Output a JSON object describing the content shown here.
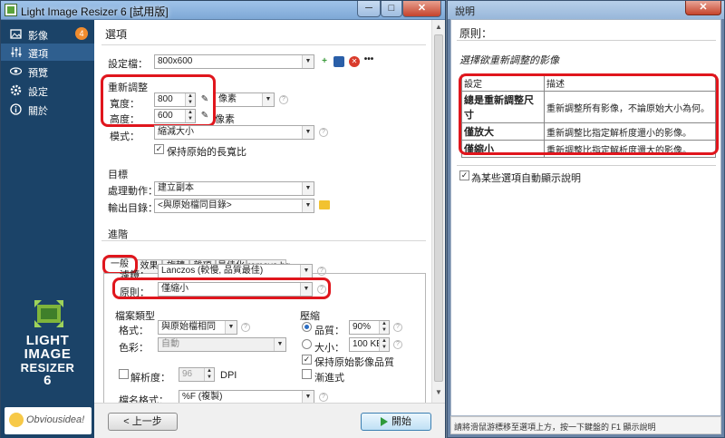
{
  "main_window": {
    "title": "Light Image Resizer 6 [試用版]",
    "controls": {
      "minimize": "─",
      "maximize": "□",
      "close": "✕"
    }
  },
  "sidebar": {
    "items": [
      {
        "icon": "images-icon",
        "label": "影像",
        "badge": "4"
      },
      {
        "icon": "options-icon",
        "label": "選項"
      },
      {
        "icon": "preview-icon",
        "label": "預覽"
      },
      {
        "icon": "settings-icon",
        "label": "設定"
      },
      {
        "icon": "about-icon",
        "label": "關於"
      }
    ],
    "brand_lines": [
      "LIGHT",
      "IMAGE",
      "RESIZER",
      "6"
    ],
    "publisher": "Obviousidea!"
  },
  "options": {
    "page_title": "選項",
    "profile_label": "設定檔：",
    "profile_value": "800x600",
    "resize_section": "重新調整",
    "width_label": "寬度：",
    "width_value": "800",
    "height_label": "高度：",
    "height_value": "600",
    "unit_value": "像素",
    "unit_static": "像素",
    "mode_label": "模式：",
    "mode_value": "縮減大小",
    "keep_ratio_label": "保持原始的長寬比",
    "target_section": "目標",
    "action_label": "處理動作：",
    "action_value": "建立副本",
    "output_label": "輸出目錄：",
    "output_value": "<與原始檔同目錄>",
    "advanced_section": "進階",
    "tabs": [
      "一般",
      "效果",
      "旋轉",
      "雜項",
      "最佳化",
      "remove.bg"
    ],
    "filter_label": "濾鏡：",
    "filter_value": "Lanczos (較慢, 品質最佳)",
    "principle_label": "原則：",
    "principle_value": "僅縮小",
    "filetype_section": "檔案類型",
    "format_label": "格式：",
    "format_value": "與原始檔相同",
    "color_label": "色彩：",
    "color_value": "自動",
    "compress_section": "壓縮",
    "quality_label": "品質：",
    "quality_value": "90%",
    "size_label": "大小：",
    "size_value": "100 KB",
    "keep_quality_label": "保持原始影像品質",
    "progressive_label": "漸進式",
    "resolution_label": "解析度：",
    "resolution_value": "96",
    "resolution_unit": "DPI",
    "filename_label": "檔名格式：",
    "filename_value": "%F (複製)",
    "back_button": "< 上一步",
    "start_button": "開始"
  },
  "help_window": {
    "title": "說明",
    "close": "✕",
    "heading": "原則：",
    "subheading": "選擇欲重新調整的影像",
    "table_headers": [
      "設定",
      "描述"
    ],
    "rows": [
      {
        "key": "總是重新調整尺寸",
        "desc": "重新調整所有影像，不論原始大小為何。"
      },
      {
        "key": "僅放大",
        "desc": "重新調整比指定解析度還小的影像。"
      },
      {
        "key": "僅縮小",
        "desc": "重新調整比指定解析度還大的影像。"
      }
    ],
    "auto_help_label": "為某些選項自動顯示說明",
    "status": "請將滑鼠游標移至選項上方，按一下鍵盤的 F1 顯示說明"
  },
  "colors": {
    "sidebar": "#1b4368",
    "highlight": "#e0161d",
    "accent_orange": "#f08c2e"
  }
}
